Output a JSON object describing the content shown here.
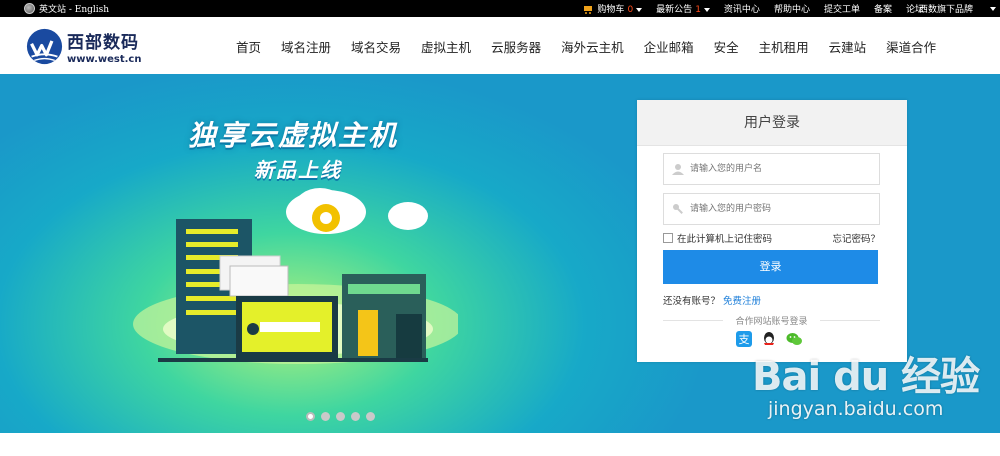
{
  "topbar": {
    "lang": "英文站 - English",
    "cart_label": "购物车",
    "cart_count": "0",
    "notice_label": "最新公告",
    "notice_count": "1",
    "links": [
      "资讯中心",
      "帮助中心",
      "提交工单",
      "备案",
      "论坛"
    ],
    "brand_menu": "西数旗下品牌"
  },
  "header": {
    "logo_cn": "西部数码",
    "logo_en": "www.west.cn",
    "nav": [
      "首页",
      "域名注册",
      "域名交易",
      "虚拟主机",
      "云服务器",
      "海外云主机",
      "企业邮箱",
      "安全",
      "主机租用",
      "云建站",
      "渠道合作"
    ]
  },
  "banner": {
    "title": "独享云虚拟主机",
    "subtitle": "新品上线",
    "password_mask": "****",
    "slides": 5,
    "active_slide": 1
  },
  "login": {
    "title": "用户登录",
    "username_placeholder": "请输入您的用户名",
    "password_placeholder": "请输入您的用户密码",
    "remember_label": "在此计算机上记住密码",
    "forgot_label": "忘记密码？",
    "submit_label": "登录",
    "no_account": "还没有账号？",
    "register_link": "免费注册",
    "partner_label": "合作网站账号登录",
    "social": [
      "alipay-icon",
      "qq-icon",
      "wechat-icon"
    ]
  },
  "watermark": {
    "logo": "Bai du 经验",
    "url": "jingyan.baidu.com"
  },
  "colors": {
    "accent": "#1e8be7",
    "brand": "#1a2a5a",
    "badge": "#ff4a1a"
  }
}
